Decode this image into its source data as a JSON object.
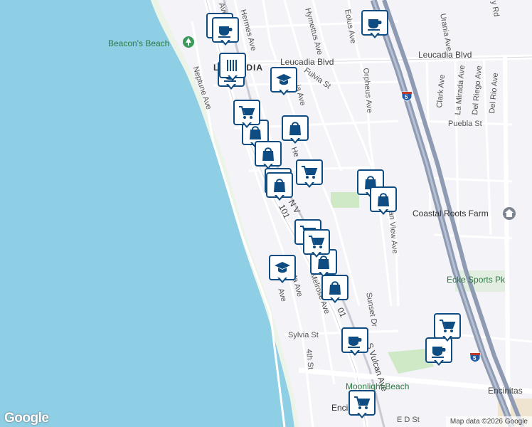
{
  "places": {
    "beacons_beach": "Beacon's Beach",
    "coastal_roots_farm": "Coastal Roots Farm",
    "ecke_sports_pk": "Ecke Sports Pk",
    "moonlight_beach": "Moonlight Beach",
    "leucadia": "LEUCADIA",
    "encinitas": "Encin"
  },
  "streets": {
    "hermes_ave": "Hermes Ave",
    "hymettus_ave": "Hymettus Ave",
    "eolus_ave": "Eolus Ave",
    "leucadia_blvd_west": "Leucadia Blvd",
    "leucadia_blvd_east": "Leucadia Blvd",
    "fulvia_st": "Fulvia St",
    "orpheus_ave_north": "Orpheus Ave",
    "orpheus_ave_south": "Orpheus Ave",
    "neptune_ave": "Neptune Ave",
    "clark_ave": "Clark Ave",
    "urania_ave": "Urania Ave",
    "la_mirada_ave": "La Mirada Ave",
    "del_riego_ave": "Del Riego Ave",
    "del_rio_ave": "Del Rio Ave",
    "puebla_st": "Puebla St",
    "ocean_view_ave": "an View Ave",
    "sunset_dr": "Sunset Dr",
    "melrose_ave": "Melrose Ave",
    "vulcan_ave": "S Vulcan Ave",
    "n_vulcan": "N V",
    "sylvia_st": "Sylvia St",
    "fourth_st": "4th St",
    "encinitas_blvd": "Encinitas",
    "ave_fragment_top": "Ave",
    "ave_fragment_mid": "Ave",
    "ave_fragment_low": "ata Ave",
    "hwy_101_a": "101",
    "hwy_101_b": "01",
    "rd_fragment": "y Rd",
    "st_fragment": "E D St",
    "he_fragment": "He",
    "ia_ave": "ia Ave"
  },
  "shields": {
    "i5_a": "5",
    "i5_b": "5"
  },
  "markers": [
    {
      "type": "coffee"
    },
    {
      "type": "coffee"
    },
    {
      "type": "coffee"
    },
    {
      "type": "coffee"
    },
    {
      "type": "school"
    },
    {
      "type": "shop"
    },
    {
      "type": "shop"
    },
    {
      "type": "grocery"
    },
    {
      "type": "shop"
    },
    {
      "type": "shop"
    },
    {
      "type": "grocery"
    },
    {
      "type": "shop"
    },
    {
      "type": "shop"
    },
    {
      "type": "shop"
    },
    {
      "type": "grocery"
    },
    {
      "type": "school"
    },
    {
      "type": "shop"
    },
    {
      "type": "shop"
    },
    {
      "type": "coffee"
    },
    {
      "type": "grocery"
    },
    {
      "type": "coffee"
    },
    {
      "type": "grocery"
    },
    {
      "type": "grocery"
    },
    {
      "type": "restaurant"
    }
  ],
  "brand": "Google",
  "attribution": "Map data ©2026 Google"
}
